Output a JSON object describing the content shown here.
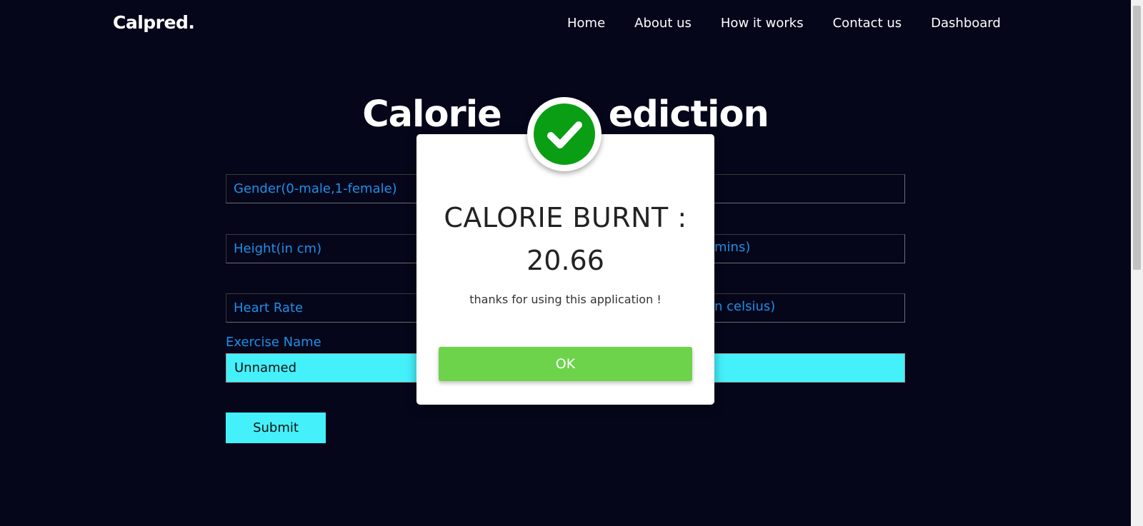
{
  "brand": "Calpred.",
  "nav": [
    {
      "label": "Home"
    },
    {
      "label": "About us"
    },
    {
      "label": "How it works"
    },
    {
      "label": "Contact us"
    },
    {
      "label": "Dashboard"
    }
  ],
  "page_title_left": "Calorie",
  "page_title_right": "ediction",
  "form": {
    "gender_placeholder": "Gender(0-male,1-female)",
    "height_placeholder": "Height(in cm)",
    "heart_rate_placeholder": "Heart Rate",
    "duration_partial": "mins)",
    "temp_partial": "n celsius)",
    "exercise_label": "Exercise Name",
    "exercise_value": "Unnamed",
    "submit_label": "Submit"
  },
  "modal": {
    "title": "CALORIE BURNT :",
    "value": "20.66",
    "message": "thanks for using this application !",
    "ok_label": "OK"
  },
  "colors": {
    "background": "#05061a",
    "accent": "#44f0fa",
    "field_text": "#1e90e8",
    "success": "#0a9e14",
    "ok_button": "#6cd34b"
  }
}
